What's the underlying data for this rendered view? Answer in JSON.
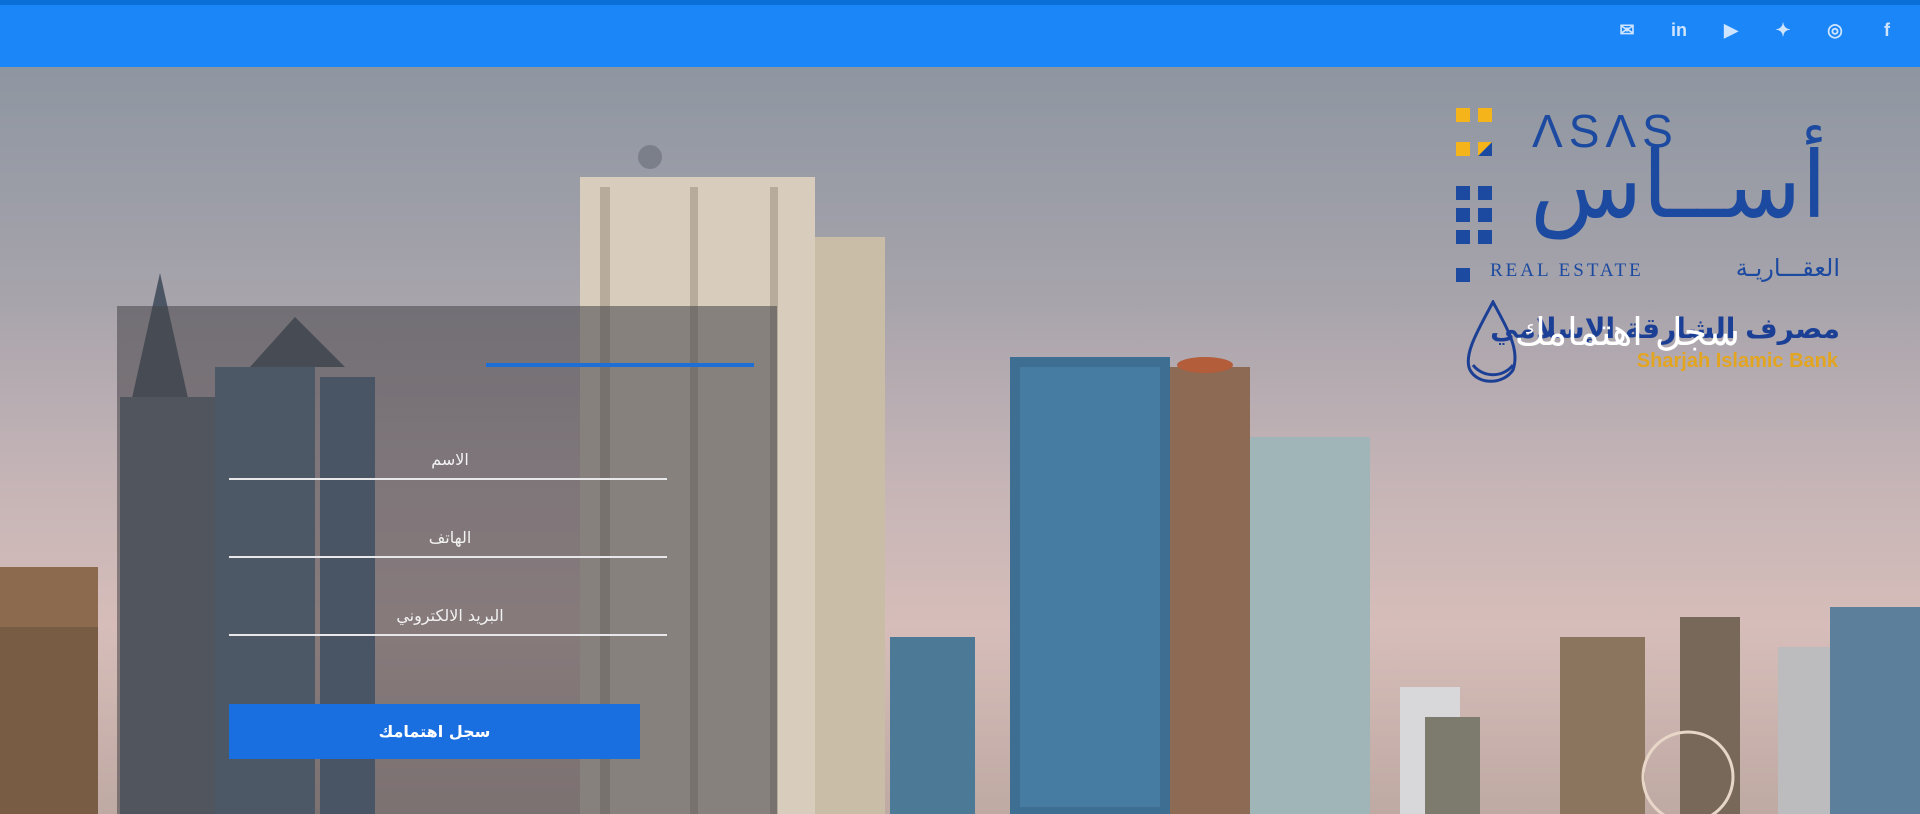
{
  "social": {
    "items": [
      {
        "name": "mail-icon",
        "glyph": "✉"
      },
      {
        "name": "linkedin-icon",
        "glyph": "in"
      },
      {
        "name": "youtube-icon",
        "glyph": "▶"
      },
      {
        "name": "twitter-icon",
        "glyph": "🐦"
      },
      {
        "name": "instagram-icon",
        "glyph": "◎"
      },
      {
        "name": "facebook-icon",
        "glyph": "f"
      }
    ]
  },
  "logo": {
    "asas_latin": "ΛSΛS",
    "asas_arabic": "أســاس",
    "real_estate": "REAL ESTATE",
    "real_estate_arabic": "العقـــاريـة",
    "bank_arabic": "مصرف الشارقة الإسلامي",
    "bank_english": "Sharjah Islamic Bank"
  },
  "form": {
    "title": "سجل اهتمامك",
    "name_placeholder": "الاسم",
    "phone_placeholder": "الهاتف",
    "email_placeholder": "البريد الالكتروني",
    "submit_label": "سجل اهتمامك"
  },
  "colors": {
    "topbar": "#1a86f7",
    "brand_blue": "#1c4aa0",
    "accent_yellow": "#f4b41a",
    "button": "#1a6fe0"
  }
}
